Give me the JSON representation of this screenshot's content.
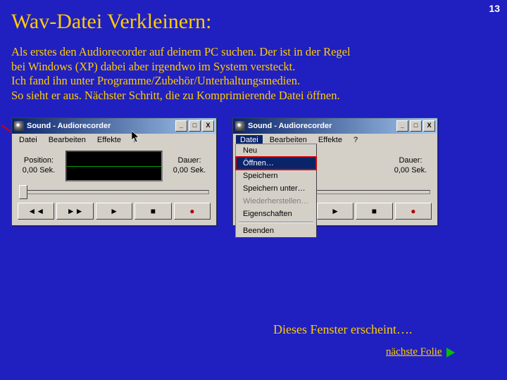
{
  "page_number": "13",
  "title": "Wav-Datei Verkleinern:",
  "body_lines": [
    "Als erstes den Audiorecorder auf deinem PC suchen. Der ist in der Regel",
    "bei Windows (XP) dabei aber irgendwo im System versteckt.",
    "Ich fand ihn unter Programme/Zubehör/Unterhaltungsmedien.",
    "So sieht er aus. Nächster Schritt, die zu Komprimierende Datei öffnen."
  ],
  "window": {
    "title": "Sound - Audiorecorder",
    "menu": {
      "datei": "Datei",
      "bearbeiten": "Bearbeiten",
      "effekte": "Effekte",
      "help": "?"
    },
    "position_label": "Position:",
    "position_value": "0,00 Sek.",
    "duration_label": "Dauer:",
    "duration_value": "0,00 Sek.",
    "btn_minus": "_",
    "btn_max": "□",
    "btn_close": "X"
  },
  "buttons": {
    "rewind": "◄◄",
    "forward": "►►",
    "play": "►",
    "stop": "■",
    "record": "●"
  },
  "dropdown": {
    "neu": "Neu",
    "oeffnen": "Öffnen…",
    "speichern": "Speichern",
    "speichern_unter": "Speichern unter…",
    "wiederherstellen": "Wiederherstellen…",
    "eigenschaften": "Eigenschaften",
    "beenden": "Beenden"
  },
  "caption": "Dieses Fenster erscheint….",
  "next": "nächste Folie"
}
